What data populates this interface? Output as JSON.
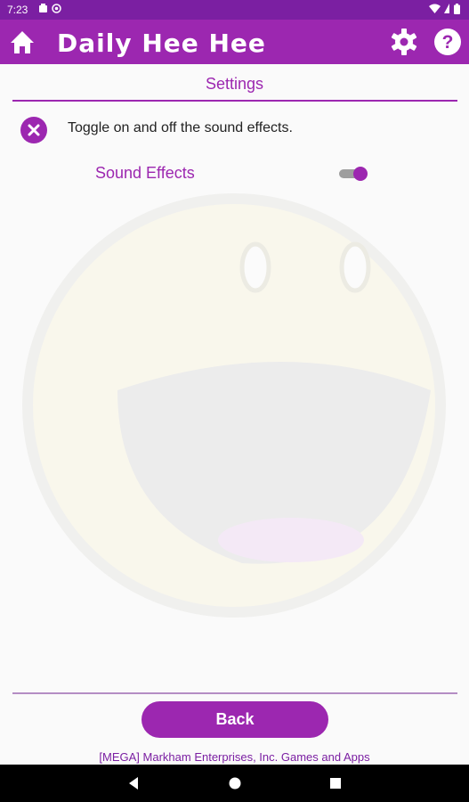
{
  "status_bar": {
    "time": "7:23",
    "icons": [
      "notification-icon",
      "nfc-icon",
      "wifi-icon",
      "battery-icon"
    ]
  },
  "app_bar": {
    "title": "Daily Hee Hee",
    "icons": [
      "home-icon",
      "gear-icon",
      "help-icon"
    ]
  },
  "page": {
    "title": "Settings"
  },
  "settings": {
    "description": "Toggle on and off the sound effects.",
    "close_icon": "close-icon",
    "sound_effects": {
      "label": "Sound Effects",
      "enabled": true
    }
  },
  "back_button": {
    "label": "Back"
  },
  "footer": {
    "text": "[MEGA] Markham Enterprises, Inc. Games and Apps"
  },
  "nav_bar": {
    "icons": [
      "back-triangle-icon",
      "home-circle-icon",
      "recents-square-icon"
    ]
  },
  "colors": {
    "primary": "#9c27b0",
    "status_bar": "#7b1fa2",
    "background": "#fafafa",
    "switch_track": "#9e9e9e"
  }
}
